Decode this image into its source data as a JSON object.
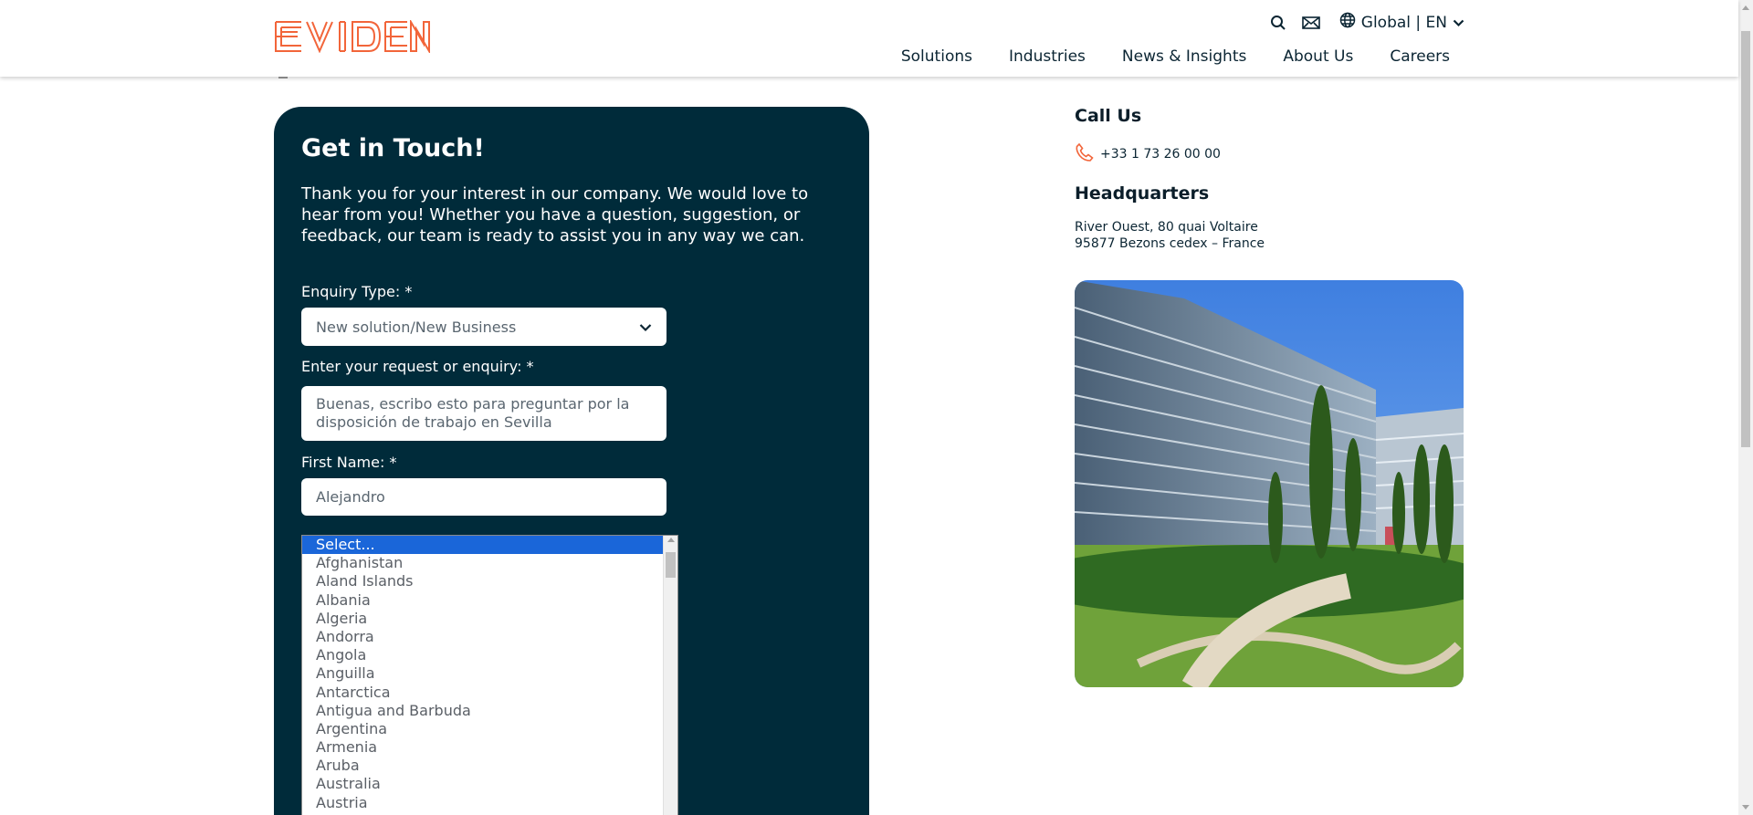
{
  "brand": {
    "logo_text": "EVIDEN",
    "accent_color": "#f2653a",
    "dark_color": "#002b3a"
  },
  "header": {
    "icons": [
      "search-icon",
      "mail-icon",
      "globe-icon"
    ],
    "language_label": "Global | EN",
    "nav": [
      "Solutions",
      "Industries",
      "News & Insights",
      "About Us",
      "Careers"
    ]
  },
  "form": {
    "title": "Get in Touch!",
    "intro": "Thank you for your interest in our company. We would love to hear from you! Whether you have a question, suggestion, or feedback, our team is ready to assist you in any way we can.",
    "enquiry_type": {
      "label": "Enquiry Type: *",
      "value": "New solution/New Business"
    },
    "request": {
      "label": "Enter your request or enquiry: *",
      "value": "Buenas, escribo esto para preguntar por la disposición de trabajo en Sevilla"
    },
    "first_name": {
      "label": "First Name: *",
      "value": "Alejandro"
    },
    "country_dropdown": {
      "selected": "Select...",
      "options": [
        "Select...",
        "Afghanistan",
        "Aland Islands",
        "Albania",
        "Algeria",
        "Andorra",
        "Angola",
        "Anguilla",
        "Antarctica",
        "Antigua and Barbuda",
        "Argentina",
        "Armenia",
        "Aruba",
        "Australia",
        "Austria"
      ]
    }
  },
  "contact": {
    "call_title": "Call Us",
    "phone": "+33 1 73 26 00 00",
    "hq_title": "Headquarters",
    "address_line1": "River Ouest, 80 quai Voltaire",
    "address_line2": "95877 Bezons cedex – France"
  }
}
